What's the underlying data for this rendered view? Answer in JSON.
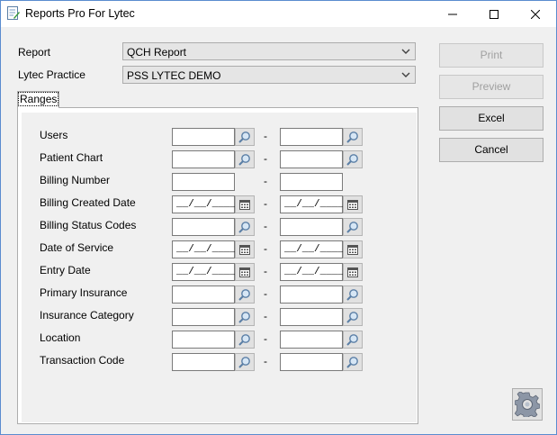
{
  "window": {
    "title": "Reports Pro For Lytec"
  },
  "form": {
    "report_label": "Report",
    "report_value": "QCH Report",
    "practice_label": "Lytec Practice",
    "practice_value": "PSS LYTEC DEMO"
  },
  "tabs": {
    "ranges": "Ranges"
  },
  "separator": "-",
  "date_mask": "__/__/____",
  "ranges": [
    {
      "label": "Users",
      "type": "lookup"
    },
    {
      "label": "Patient Chart",
      "type": "lookup"
    },
    {
      "label": "Billing Number",
      "type": "text"
    },
    {
      "label": "Billing Created Date",
      "type": "date"
    },
    {
      "label": "Billing Status Codes",
      "type": "lookup"
    },
    {
      "label": "Date of Service",
      "type": "date"
    },
    {
      "label": "Entry Date",
      "type": "date"
    },
    {
      "label": "Primary Insurance",
      "type": "lookup"
    },
    {
      "label": "Insurance Category",
      "type": "lookup"
    },
    {
      "label": "Location",
      "type": "lookup"
    },
    {
      "label": "Transaction Code",
      "type": "lookup"
    }
  ],
  "buttons": {
    "print": "Print",
    "preview": "Preview",
    "excel": "Excel",
    "cancel": "Cancel"
  },
  "icons": {
    "lookup": "magnifier-icon",
    "date": "calendar-icon",
    "settings": "gear-icon"
  }
}
